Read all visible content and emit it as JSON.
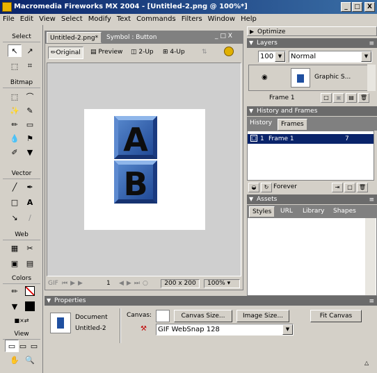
{
  "window": {
    "title": "Macromedia Fireworks MX 2004 - [Untitled-2.png @ 100%*]",
    "min": "_",
    "max": "□",
    "close": "X"
  },
  "menu": [
    "File",
    "Edit",
    "View",
    "Select",
    "Modify",
    "Text",
    "Commands",
    "Filters",
    "Window",
    "Help"
  ],
  "tools": {
    "sections": {
      "select": "Select",
      "bitmap": "Bitmap",
      "vector": "Vector",
      "web": "Web",
      "colors": "Colors",
      "view": "View"
    }
  },
  "document": {
    "tabs": [
      {
        "label": "Untitled-2.png*",
        "active": true
      },
      {
        "label": "Symbol : Button",
        "active": false
      }
    ],
    "doc_min": "_",
    "doc_max": "□",
    "doc_close": "X",
    "views": {
      "original": "Original",
      "preview": "Preview",
      "two_up": "2-Up",
      "four_up": "4-Up"
    },
    "letters": [
      "A",
      "B"
    ],
    "status": {
      "format": "GIF",
      "frame": "1",
      "size": "200 x 200",
      "zoom": "100%"
    }
  },
  "panels": {
    "optimize": "Optimize",
    "layers": {
      "title": "Layers",
      "opacity": "100",
      "blend": "Normal",
      "layer_name": "Graphic S...",
      "frame_label": "Frame 1"
    },
    "history_frames": {
      "title": "History and Frames",
      "tabs": [
        {
          "label": "History",
          "active": false
        },
        {
          "label": "Frames",
          "active": true
        }
      ],
      "frame": {
        "num": "1",
        "name": "Frame 1",
        "delay": "7"
      },
      "loop": "Forever"
    },
    "assets": {
      "title": "Assets",
      "tabs": [
        {
          "label": "Styles",
          "active": true
        },
        {
          "label": "URL",
          "active": false
        },
        {
          "label": "Library",
          "active": false
        },
        {
          "label": "Shapes",
          "active": false
        }
      ]
    }
  },
  "properties": {
    "title": "Properties",
    "type": "Document",
    "name": "Untitled-2",
    "canvas_label": "Canvas:",
    "canvas_size_btn": "Canvas Size...",
    "image_size_btn": "Image Size...",
    "fit_canvas_btn": "Fit Canvas",
    "palette": "GIF WebSnap 128"
  },
  "colors": {
    "accent": "#0a246a",
    "panel_dark": "#6b6b6b",
    "button_blue": "#1f4fa0"
  }
}
